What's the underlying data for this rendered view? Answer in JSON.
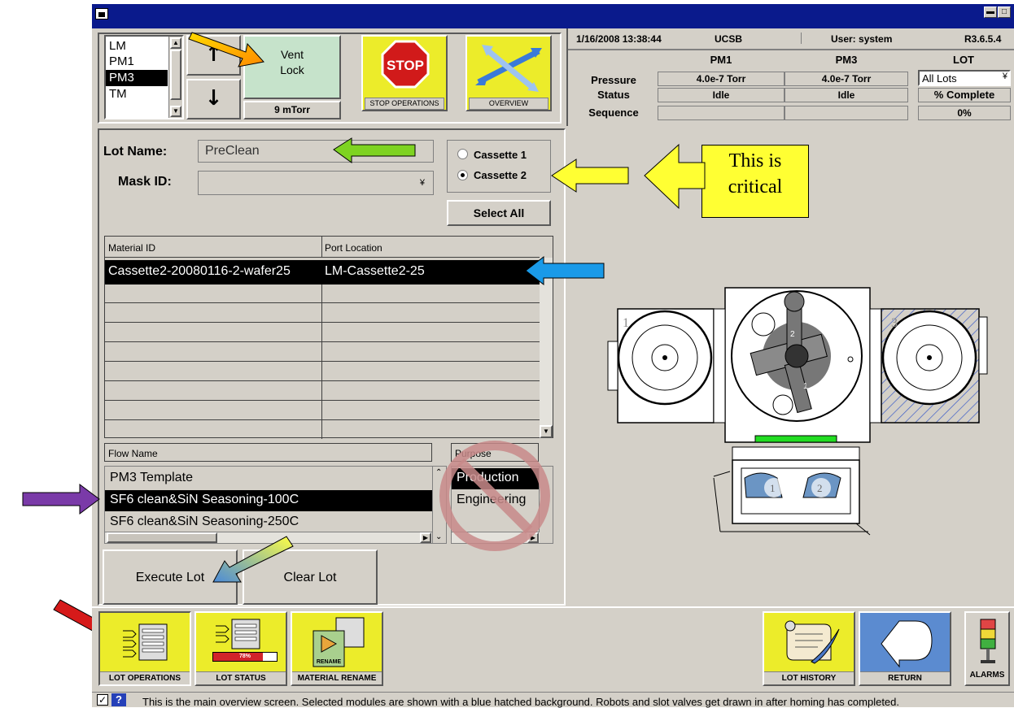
{
  "window": {
    "min_glyph": "▬",
    "max_glyph": "□"
  },
  "module_list": {
    "items": [
      "LM",
      "PM1",
      "PM3",
      "TM"
    ],
    "selected": "PM3"
  },
  "arrows": {
    "up": "↑",
    "down": "↓"
  },
  "vent": {
    "label_line1": "Vent",
    "label_line2": "Lock",
    "pressure": "9 mTorr"
  },
  "stop": {
    "sign": "STOP",
    "label": "STOP OPERATIONS"
  },
  "overview": {
    "label": "OVERVIEW"
  },
  "status": {
    "datetime": "1/16/2008  13:38:44",
    "site": "UCSB",
    "user": "User: system",
    "version": "R3.6.5.4",
    "col_pm1": "PM1",
    "col_pm3": "PM3",
    "col_lot": "LOT",
    "row_pressure": "Pressure",
    "row_status": "Status",
    "row_sequence": "Sequence",
    "pm1_pressure": "4.0e-7  Torr",
    "pm3_pressure": "4.0e-7  Torr",
    "pm1_status": "Idle",
    "pm3_status": "Idle",
    "lot_select": "All Lots",
    "lot_complete_label": "% Complete",
    "lot_complete_value": "0%"
  },
  "lot": {
    "name_label": "Lot Name:",
    "name_value": "PreClean",
    "mask_label": "Mask ID:",
    "mask_value": ""
  },
  "cassettes": {
    "c1": "Cassette 1",
    "c2": "Cassette 2",
    "select_all": "Select All",
    "selected": "Cassette 2"
  },
  "callout": {
    "line1": "This is",
    "line2": "critical"
  },
  "material_table": {
    "col_material": "Material ID",
    "col_port": "Port Location",
    "rows": [
      {
        "material": "Cassette2-20080116-2-wafer25",
        "port": "LM-Cassette2-25"
      }
    ]
  },
  "flow_table": {
    "col_flow": "Flow Name",
    "col_purpose": "Purpose",
    "flows": [
      "PM3 Template",
      "SF6 clean&SiN Seasoning-100C",
      "SF6 clean&SiN Seasoning-250C"
    ],
    "selected_flow": "SF6 clean&SiN Seasoning-100C",
    "purposes": [
      "Production",
      "Engineering"
    ]
  },
  "actions": {
    "execute": "Execute Lot",
    "clear": "Clear Lot"
  },
  "toolbar": {
    "lot_operations": "LOT OPERATIONS",
    "lot_status": "LOT STATUS",
    "lot_status_percent": "78%",
    "material_rename": "MATERIAL RENAME",
    "rename_tag": "RENAME",
    "lot_history": "LOT HISTORY",
    "return": "RETURN",
    "alarms": "ALARMS"
  },
  "schematic": {
    "pm1_label": "1",
    "pm3_label": "3",
    "arm1": "1",
    "arm2": "2",
    "slot1": "1",
    "slot2": "2"
  },
  "statusbar": {
    "check": "✓",
    "help": "?",
    "message": "This is the main overview screen.  Selected modules are shown with a blue hatched background.  Robots and slot valves get drawn in after homing has completed."
  },
  "colors": {
    "title_bar": "#0a1a8c",
    "panel": "#d4d0c8",
    "button_yellow": "#ecec2a",
    "vent_green": "#c6e3cb",
    "callout_yellow": "#ffff33",
    "selection": "#000000"
  }
}
